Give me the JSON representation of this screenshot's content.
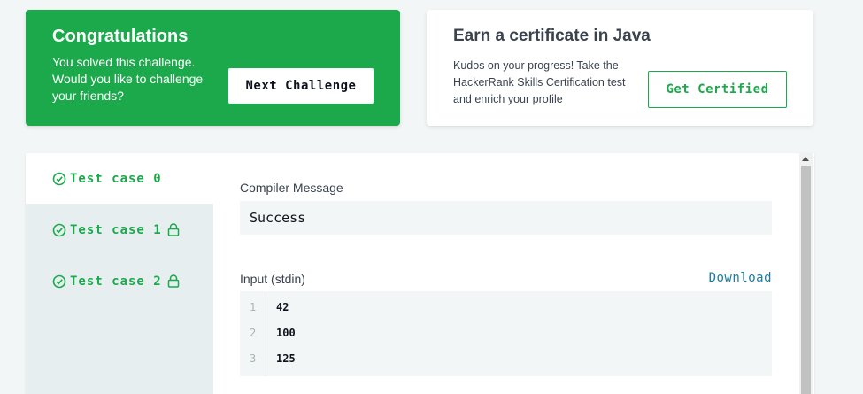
{
  "congrats": {
    "title": "Congratulations",
    "message": "You solved this challenge. Would you like to challenge your friends?",
    "next_label": "Next Challenge"
  },
  "certificate": {
    "title": "Earn a certificate in Java",
    "message": "Kudos on your progress! Take the HackerRank Skills Certification test and enrich your profile",
    "button_label": "Get Certified"
  },
  "test_cases": [
    {
      "label": "Test case 0",
      "passed": true,
      "locked": false,
      "active": true
    },
    {
      "label": "Test case 1",
      "passed": true,
      "locked": true,
      "active": false
    },
    {
      "label": "Test case 2",
      "passed": true,
      "locked": true,
      "active": false
    }
  ],
  "result": {
    "compiler_label": "Compiler Message",
    "compiler_message": "Success",
    "input_label": "Input (stdin)",
    "download_label": "Download",
    "input_lines": [
      {
        "num": "1",
        "text": "42"
      },
      {
        "num": "2",
        "text": "100"
      },
      {
        "num": "3",
        "text": "125"
      }
    ]
  },
  "colors": {
    "accent_green": "#1ba94c",
    "link_blue": "#1a7ba3"
  },
  "icons": {
    "pass": "check-circle-icon",
    "locked": "lock-icon"
  }
}
